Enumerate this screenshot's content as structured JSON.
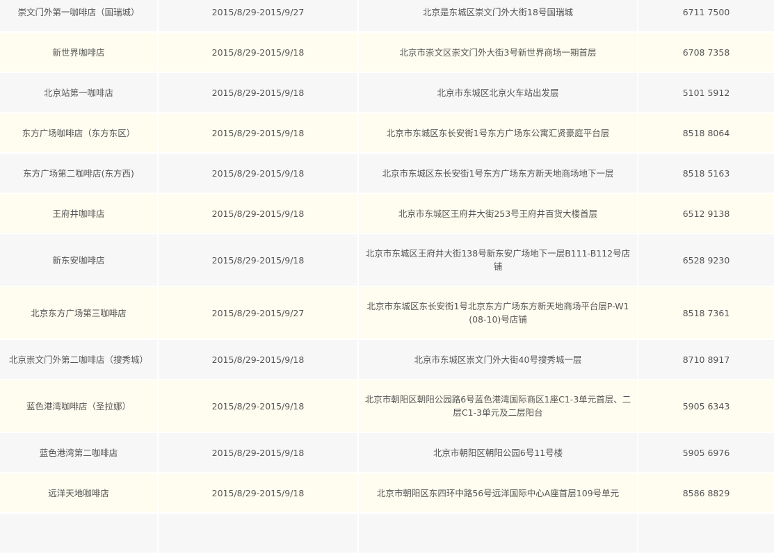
{
  "rows": [
    {
      "name": "崇文门外第一咖啡店（国瑞城）",
      "date": "2015/8/29-2015/9/27",
      "address": "北京是东城区崇文门外大街18号国瑞城",
      "phone": "6711 7500"
    },
    {
      "name": "新世界咖啡店",
      "date": "2015/8/29-2015/9/18",
      "address": "北京市崇文区崇文门外大街3号新世界商场一期首层",
      "phone": "6708 7358"
    },
    {
      "name": "北京站第一咖啡店",
      "date": "2015/8/29-2015/9/18",
      "address": "北京市东城区北京火车站出发层",
      "phone": "5101 5912"
    },
    {
      "name": "东方广场咖啡店（东方东区）",
      "date": "2015/8/29-2015/9/18",
      "address": "北京市东城区东长安街1号东方广场东公寓汇贤豪庭平台层",
      "phone": "8518 8064"
    },
    {
      "name": "东方广场第二咖啡店(东方西)",
      "date": "2015/8/29-2015/9/18",
      "address": "北京市东城区东长安街1号东方广场东方新天地商场地下一层",
      "phone": "8518 5163"
    },
    {
      "name": "王府井咖啡店",
      "date": "2015/8/29-2015/9/18",
      "address": "北京市东城区王府井大街253号王府井百货大楼首层",
      "phone": "6512 9138"
    },
    {
      "name": "新东安咖啡店",
      "date": "2015/8/29-2015/9/18",
      "address": "北京市东城区王府井大街138号新东安广场地下一层B111-B112号店铺",
      "phone": "6528 9230"
    },
    {
      "name": "北京东方广场第三咖啡店",
      "date": "2015/8/29-2015/9/27",
      "address": "北京市东城区东长安街1号北京东方广场东方新天地商场平台层P-W1(08-10)号店铺",
      "phone": "8518 7361"
    },
    {
      "name": "北京崇文门外第二咖啡店（搜秀城）",
      "date": "2015/8/29-2015/9/18",
      "address": "北京市东城区崇文门外大街40号搜秀城一层",
      "phone": "8710 8917"
    },
    {
      "name": "蓝色港湾咖啡店（圣拉娜）",
      "date": "2015/8/29-2015/9/18",
      "address": "北京市朝阳区朝阳公园路6号蓝色港湾国际商区1座C1-3单元首层、二层C1-3单元及二层阳台",
      "phone": "5905 6343"
    },
    {
      "name": "蓝色港湾第二咖啡店",
      "date": "2015/8/29-2015/9/18",
      "address": "北京市朝阳区朝阳公园6号11号楼",
      "phone": "5905 6976"
    },
    {
      "name": "远洋天地咖啡店",
      "date": "2015/8/29-2015/9/18",
      "address": "北京市朝阳区东四环中路56号远洋国际中心A座首层109号单元",
      "phone": "8586 8829"
    }
  ]
}
